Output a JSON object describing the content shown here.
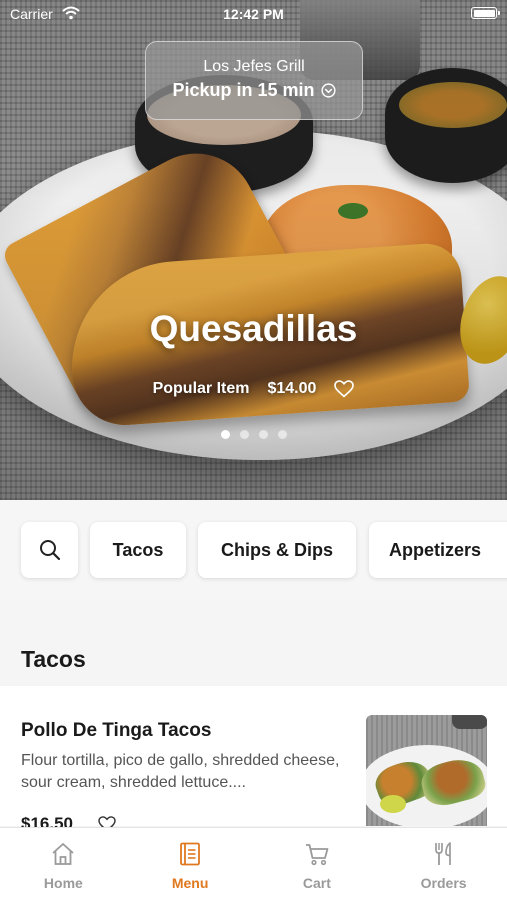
{
  "status_bar": {
    "carrier": "Carrier",
    "time": "12:42 PM"
  },
  "pickup": {
    "restaurant": "Los Jefes Grill",
    "status": "Pickup in 15 min"
  },
  "hero": {
    "title": "Quesadillas",
    "tag": "Popular Item",
    "price": "$14.00",
    "carousel_total": 4,
    "carousel_active": 1
  },
  "categories": [
    {
      "label": "Tacos"
    },
    {
      "label": "Chips & Dips"
    },
    {
      "label": "Appetizers"
    }
  ],
  "section": {
    "title": "Tacos"
  },
  "menu_items": [
    {
      "name": "Pollo De Tinga Tacos",
      "description": "Flour tortilla, pico de gallo, shredded cheese, sour cream, shredded lettuce....",
      "price": "$16.50"
    }
  ],
  "tab_bar": {
    "items": [
      {
        "label": "Home",
        "icon": "home-icon"
      },
      {
        "label": "Menu",
        "icon": "menu-book-icon"
      },
      {
        "label": "Cart",
        "icon": "cart-icon"
      },
      {
        "label": "Orders",
        "icon": "fork-knife-icon"
      }
    ],
    "active": "Menu",
    "active_color": "#e0781f",
    "inactive_color": "#9a9a9a"
  }
}
